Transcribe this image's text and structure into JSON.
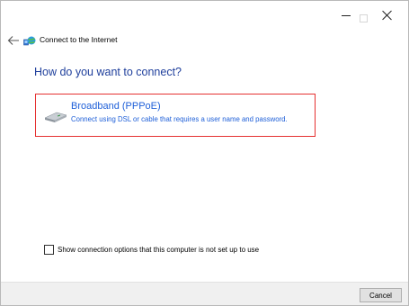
{
  "window": {
    "title": "Connect to the Internet"
  },
  "page": {
    "question": "How do you want to connect?"
  },
  "option": {
    "title": "Broadband (PPPoE)",
    "description": "Connect using DSL or cable that requires a user name and password."
  },
  "checkbox": {
    "label": "Show connection options that this computer is not set up to use",
    "checked": false
  },
  "footer": {
    "cancel_label": "Cancel"
  },
  "colors": {
    "accent": "#1e5fd8",
    "heading": "#1f3f9c",
    "selection_border": "#e53030"
  },
  "icons": {
    "back": "back-arrow-icon",
    "header": "network-globe-icon",
    "option": "modem-icon"
  }
}
